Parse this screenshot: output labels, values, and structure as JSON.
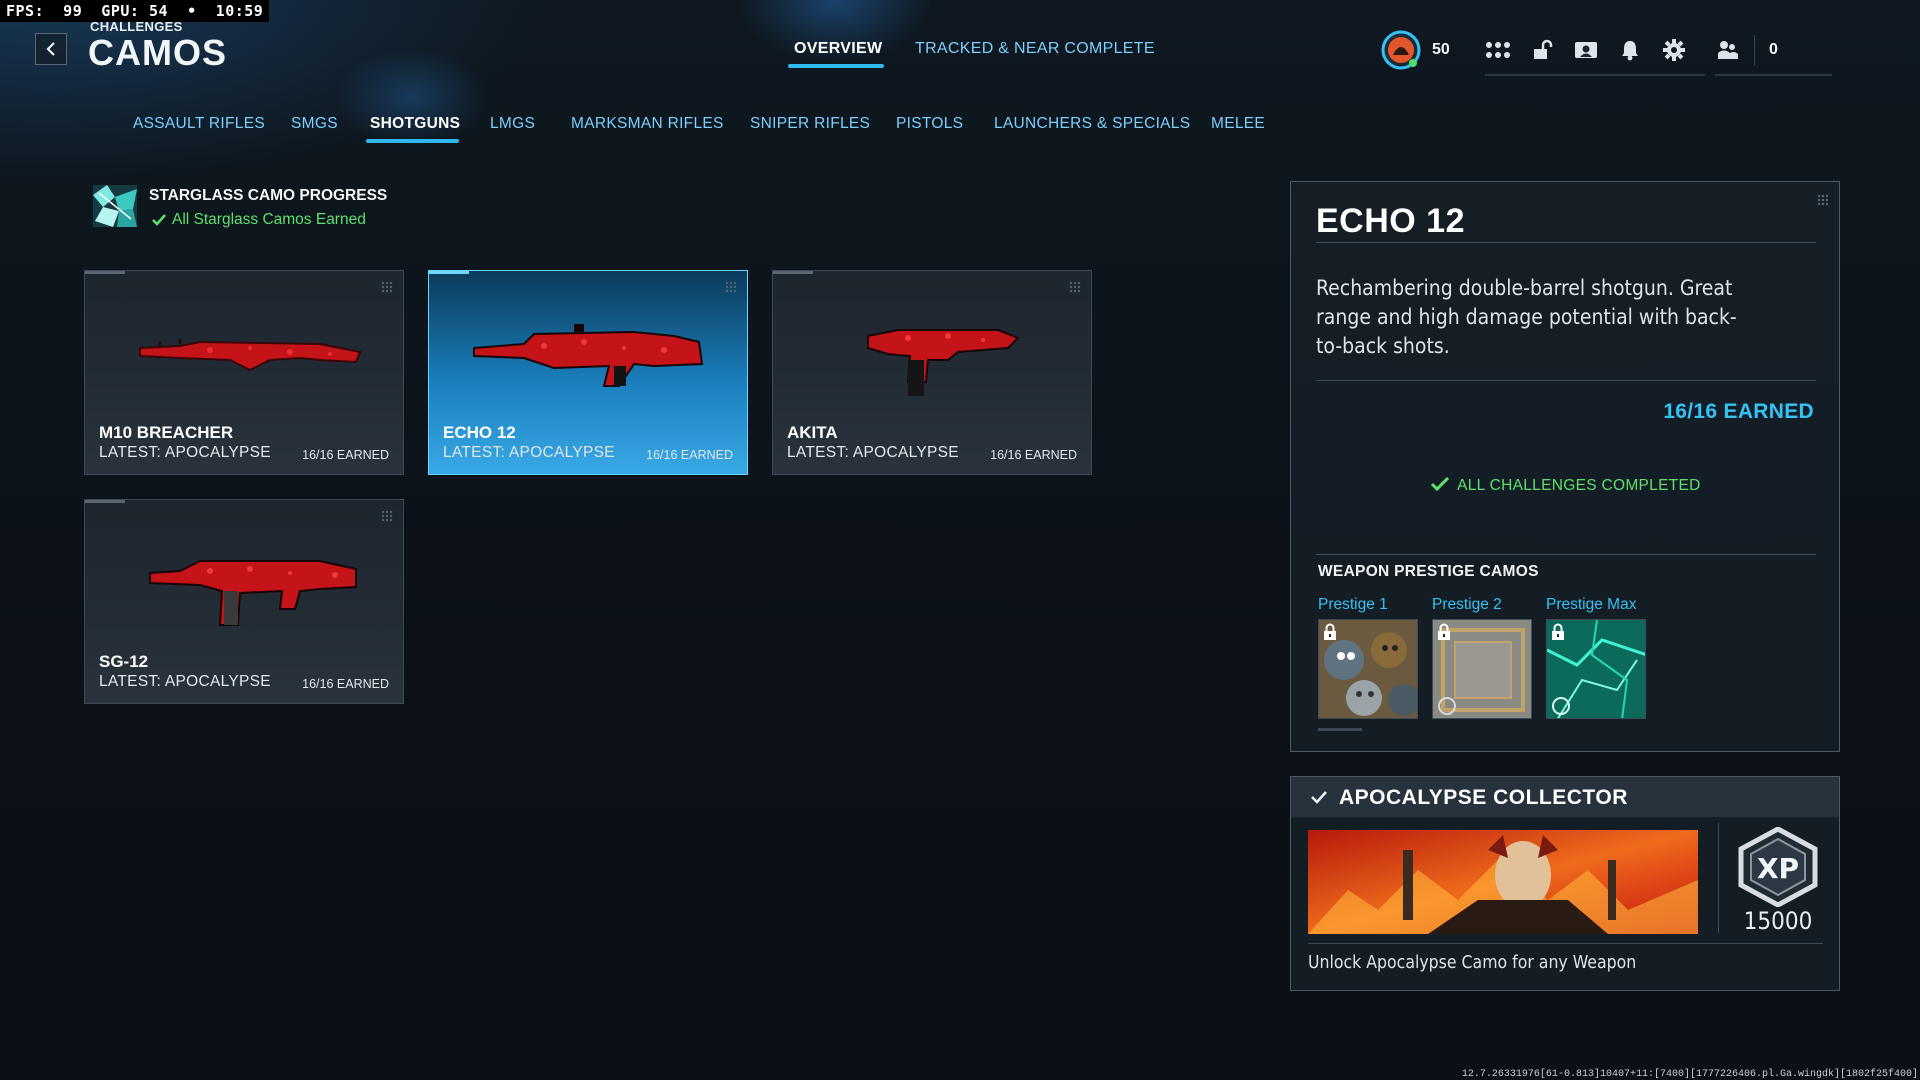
{
  "overlay": {
    "fps_text": "FPS:  99  GPU: 54  •  10:59"
  },
  "header": {
    "breadcrumb": "CHALLENGES",
    "title": "CAMOS"
  },
  "top_tabs": [
    {
      "label": "OVERVIEW",
      "active": true
    },
    {
      "label": "TRACKED & NEAR COMPLETE",
      "active": false
    }
  ],
  "hud": {
    "level": "50",
    "friends_count": "0"
  },
  "class_tabs": [
    {
      "label": "ASSAULT RIFLES"
    },
    {
      "label": "SMGS"
    },
    {
      "label": "SHOTGUNS",
      "active": true
    },
    {
      "label": "LMGS"
    },
    {
      "label": "MARKSMAN RIFLES"
    },
    {
      "label": "SNIPER RIFLES"
    },
    {
      "label": "PISTOLS"
    },
    {
      "label": "LAUNCHERS & SPECIALS"
    },
    {
      "label": "MELEE"
    }
  ],
  "progress": {
    "title": "STARGLASS CAMO PROGRESS",
    "status": "All Starglass Camos Earned"
  },
  "weapons": [
    {
      "name": "M10 BREACHER",
      "latest": "LATEST: APOCALYPSE",
      "earned": "16/16 EARNED",
      "selected": false
    },
    {
      "name": "ECHO 12",
      "latest": "LATEST: APOCALYPSE",
      "earned": "16/16 EARNED",
      "selected": true
    },
    {
      "name": "AKITA",
      "latest": "LATEST: APOCALYPSE",
      "earned": "16/16 EARNED",
      "selected": false
    },
    {
      "name": "SG-12",
      "latest": "LATEST: APOCALYPSE",
      "earned": "16/16 EARNED",
      "selected": false
    }
  ],
  "detail": {
    "title": "ECHO 12",
    "description": "Rechambering double-barrel shotgun. Great range and high damage potential with back-to-back shots.",
    "earned": "16/16 EARNED",
    "challenges_status": "ALL CHALLENGES COMPLETED",
    "prestige_heading": "WEAPON PRESTIGE CAMOS",
    "prestige": [
      {
        "label": "Prestige 1"
      },
      {
        "label": "Prestige 2"
      },
      {
        "label": "Prestige Max"
      }
    ]
  },
  "collector": {
    "title": "APOCALYPSE COLLECTOR",
    "xp_badge": "XP",
    "xp": "15000",
    "description": "Unlock Apocalypse Camo for any Weapon"
  },
  "footer": {
    "build": "12.7.26331976[61-0.813]10407+11:[7400][1777226406.pl.Ga.wingdk][1802f25f400]"
  },
  "colors": {
    "accent": "#35c2f5",
    "success": "#5fe06b",
    "selected_card": "#1a7fbd",
    "camo_red": "#d21a1a"
  }
}
